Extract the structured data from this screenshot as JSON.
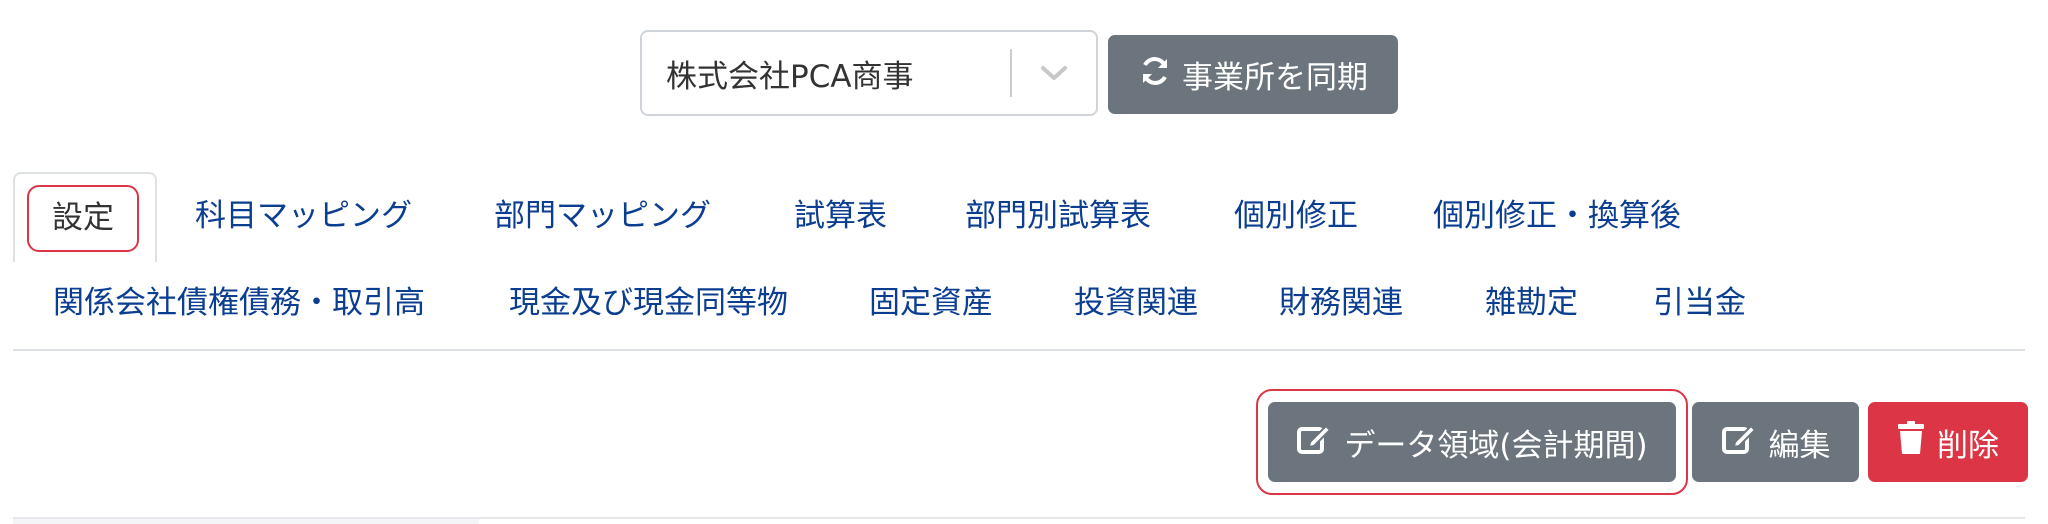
{
  "company_select": {
    "value": "株式会社PCA商事",
    "caret_icon": "chevron-down-icon"
  },
  "sync_button": {
    "label": "事業所を同期",
    "icon": "sync-icon"
  },
  "tabs": {
    "row1": [
      "設定",
      "科目マッピング",
      "部門マッピング",
      "試算表",
      "部門別試算表",
      "個別修正",
      "個別修正・換算後"
    ],
    "row2": [
      "関係会社債権債務・取引高",
      "現金及び現金同等物",
      "固定資産",
      "投資関連",
      "財務関連",
      "雑勘定",
      "引当金"
    ],
    "active": "設定"
  },
  "actions": {
    "data_area": {
      "label": "データ領域(会計期間)",
      "icon": "edit-icon"
    },
    "edit": {
      "label": "編集",
      "icon": "edit-icon"
    },
    "delete": {
      "label": "削除",
      "icon": "trash-icon"
    }
  },
  "colors": {
    "tab_text": "#0b3d91",
    "secondary_button": "#6c757d",
    "danger_button": "#dc3545",
    "highlight_outline": "#dc3545"
  }
}
